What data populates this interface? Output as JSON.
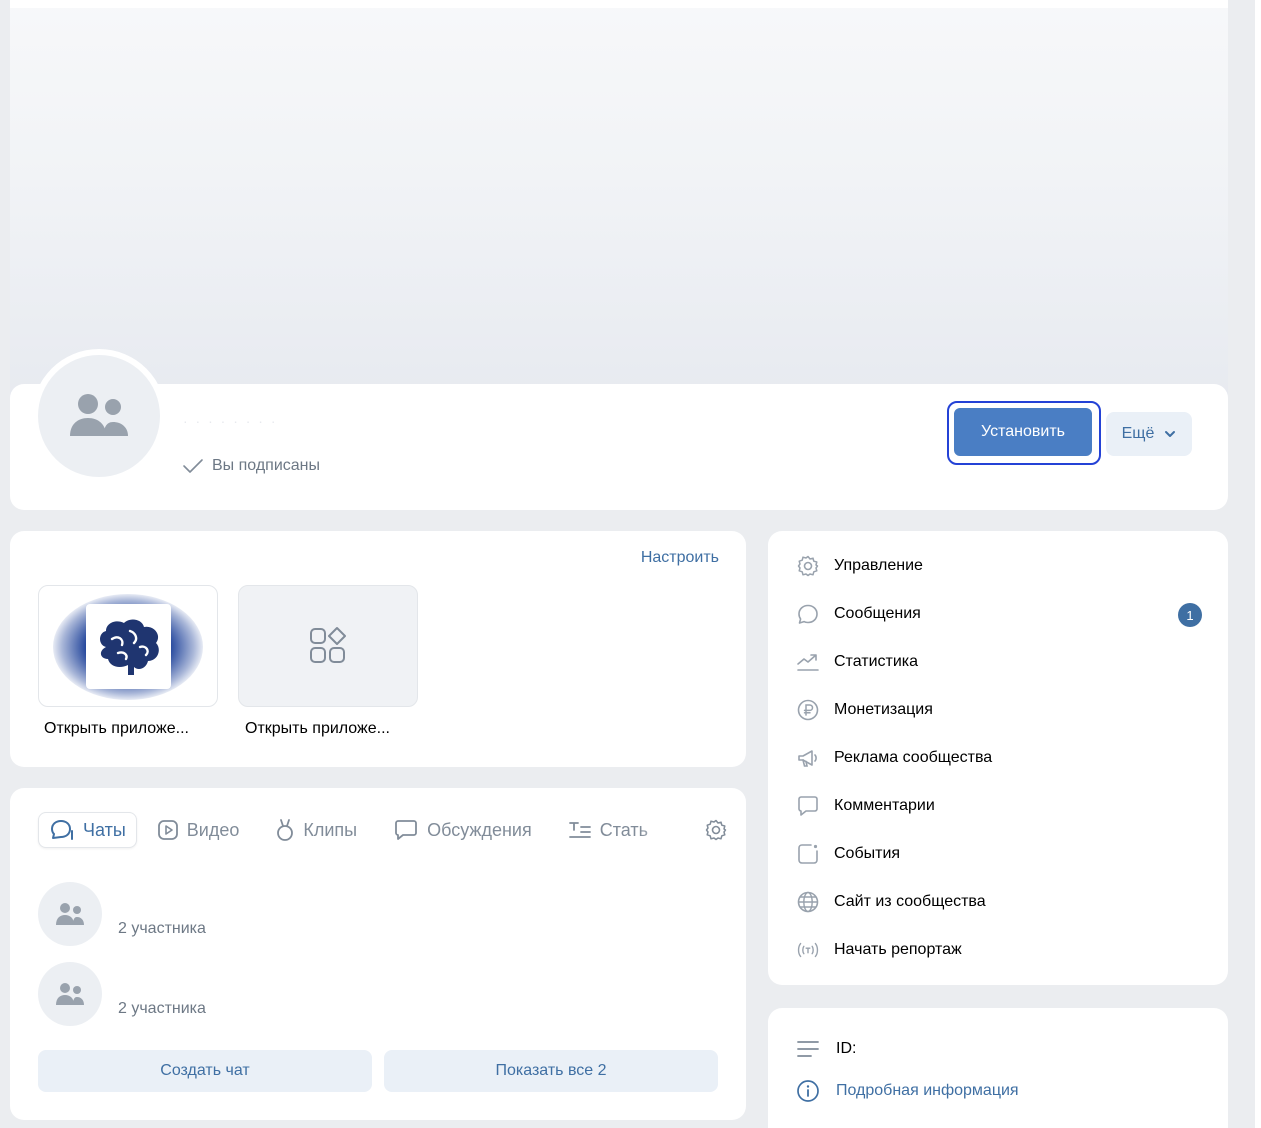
{
  "header": {
    "group_name": "· · · · · · · ·",
    "subscribed_label": "Вы подписаны",
    "install_label": "Установить",
    "more_label": "Ещё"
  },
  "apps": {
    "setup_label": "Настроить",
    "items": [
      {
        "label": "Открыть приложе..."
      },
      {
        "label": "Открыть приложе..."
      }
    ]
  },
  "chats": {
    "tabs": [
      {
        "label": "Чаты",
        "active": true,
        "icon": "chat-icon"
      },
      {
        "label": "Видео",
        "active": false,
        "icon": "video-icon"
      },
      {
        "label": "Клипы",
        "active": false,
        "icon": "clips-icon"
      },
      {
        "label": "Обсуждения",
        "active": false,
        "icon": "discussion-icon"
      },
      {
        "label": "Стать",
        "active": false,
        "icon": "articles-icon"
      }
    ],
    "items": [
      {
        "members": "2 участника"
      },
      {
        "members": "2 участника"
      }
    ],
    "create_label": "Создать чат",
    "show_all_label": "Показать все 2"
  },
  "menu": {
    "items": [
      {
        "label": "Управление",
        "icon": "gear-icon"
      },
      {
        "label": "Сообщения",
        "icon": "message-icon",
        "badge": "1"
      },
      {
        "label": "Статистика",
        "icon": "stats-icon"
      },
      {
        "label": "Монетизация",
        "icon": "ruble-icon"
      },
      {
        "label": "Реклама сообщества",
        "icon": "megaphone-icon"
      },
      {
        "label": "Комментарии",
        "icon": "comment-icon"
      },
      {
        "label": "События",
        "icon": "event-icon"
      },
      {
        "label": "Сайт из сообщества",
        "icon": "globe-icon"
      },
      {
        "label": "Начать репортаж",
        "icon": "broadcast-icon"
      }
    ]
  },
  "info": {
    "id_label": "ID:",
    "details_label": "Подробная информация"
  },
  "colors": {
    "accent": "#3f6fa3",
    "primary_button": "#4a7ec4",
    "focus_ring": "#2442d6",
    "page_bg": "#ebedf0"
  }
}
